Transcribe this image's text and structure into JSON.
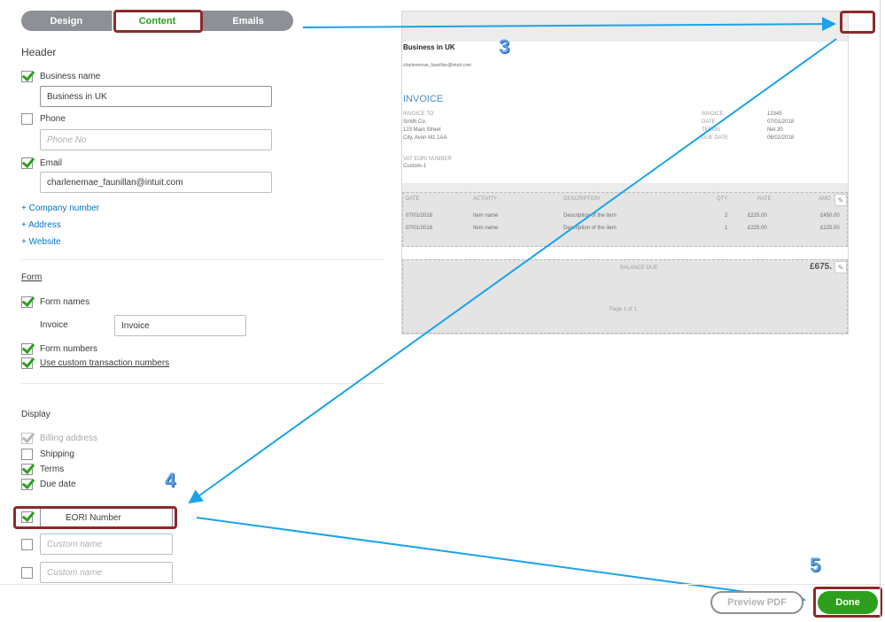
{
  "tabs": [
    "Design",
    "Content",
    "Emails"
  ],
  "header": {
    "title": "Header",
    "business_name_label": "Business name",
    "business_name_value": "Business in UK",
    "phone_label": "Phone",
    "phone_placeholder": "Phone No",
    "email_label": "Email",
    "email_value": "charlenemae_faunillan@intuit.com",
    "links": [
      "+ Company number",
      "+ Address",
      "+ Website"
    ]
  },
  "form": {
    "title": "Form",
    "form_names_label": "Form names",
    "invoice_label": "Invoice",
    "invoice_value": "Invoice",
    "form_numbers_label": "Form numbers",
    "custom_numbers_label": "Use custom transaction numbers"
  },
  "display": {
    "title": "Display",
    "items": [
      "Billing address",
      "Shipping",
      "Terms",
      "Due date"
    ],
    "eori_value": "EORI Number",
    "custom_placeholder": "Custom name"
  },
  "preview": {
    "business": "Business in UK",
    "email": "charlenemae_faunillan@intuit.com",
    "invoice_title": "INVOICE",
    "invoice_to_label": "INVOICE TO",
    "address": [
      "Smith Co.",
      "123 Main Street",
      "City, Avon M1 1AA"
    ],
    "meta_labels": [
      "INVOICE",
      "DATE",
      "TERMS",
      "DUE DATE"
    ],
    "meta_values": [
      "12345",
      "07/01/2018",
      "Net 30",
      "06/02/2018"
    ],
    "vat_label": "VAT EORI NUMBER",
    "vat_value": "Custom-1",
    "columns": [
      "DATE",
      "ACTIVITY",
      "DESCRIPTION",
      "QTY",
      "RATE",
      "AMO"
    ],
    "rows": [
      [
        "07/01/2018",
        "Item name",
        "Description of the item",
        "2",
        "£225.00",
        "£450.00"
      ],
      [
        "07/01/2018",
        "Item name",
        "Description of the item",
        "1",
        "£225.00",
        "£225.00"
      ]
    ],
    "balance_label": "BALANCE DUE",
    "balance_value": "£675.",
    "page_label": "Page 1 of 1"
  },
  "steps": [
    "3",
    "4",
    "5"
  ],
  "buttons": {
    "preview": "Preview PDF",
    "done": "Done"
  },
  "colors": {
    "accent_green": "#2ca01c",
    "highlight_red": "#8b2a2a",
    "arrow_blue": "#1aa3e8",
    "link_blue": "#0077c5"
  }
}
